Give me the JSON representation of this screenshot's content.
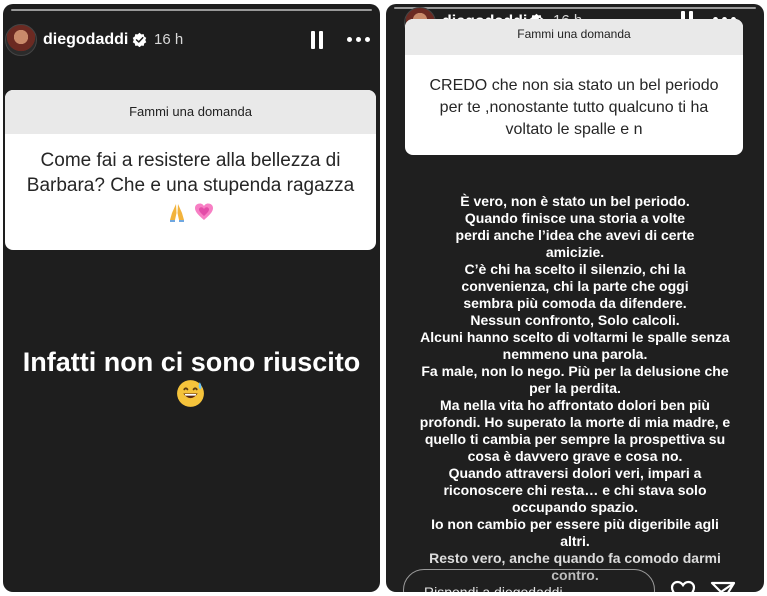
{
  "stories": [
    {
      "username": "diegodaddi",
      "time_ago": "16 h",
      "question_header": "Fammi una domanda",
      "question_text": "Come fai  a resistere alla bellezza di Barbara?  Che e una stupenda ragazza",
      "question_emojis": "🙏💓",
      "caption": "Infatti non ci sono riuscito",
      "caption_emoji": "😅"
    },
    {
      "username": "diegodaddi",
      "time_ago": "16 h",
      "question_header": "Fammi una domanda",
      "question_text": "CREDO che non sia stato un bel periodo per te ,nonostante tutto qualcuno ti ha voltato le spalle e n",
      "answer_lines": [
        "È vero, non è stato un bel periodo.",
        "Quando finisce una storia a volte",
        "perdi anche l’idea che avevi di certe",
        "amicizie.",
        "C’è chi ha scelto il silenzio, chi la",
        "convenienza, chi la parte che oggi",
        "sembra più comoda da difendere.",
        "Nessun confronto, Solo calcoli.",
        "Alcuni hanno scelto di voltarmi le spalle senza",
        "nemmeno una parola.",
        "Fa male, non lo nego. Più per la delusione che",
        "per la perdita.",
        "Ma nella vita ho affrontato dolori ben più",
        "profondi. Ho superato la morte di mia madre, e",
        "quello ti cambia per sempre la prospettiva su",
        "cosa è davvero grave e cosa no.",
        "Quando attraversi dolori veri, impari a",
        "riconoscere chi resta… e chi stava solo",
        "occupando spazio.",
        "Io non cambio per essere più digeribile agli",
        "altri.",
        "Resto vero, anche quando fa comodo darmi",
        "contro."
      ],
      "reply_placeholder": "Rispondi a diegodaddi..."
    }
  ]
}
